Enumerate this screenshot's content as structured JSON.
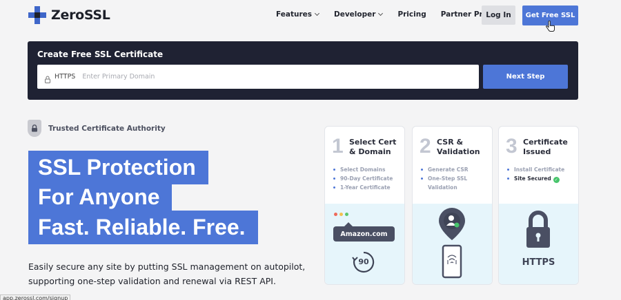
{
  "brand": {
    "name": "ZeroSSL"
  },
  "nav": {
    "items": [
      {
        "label": "Features"
      },
      {
        "label": "Developer"
      },
      {
        "label": "Pricing"
      },
      {
        "label": "Partner Program"
      }
    ],
    "login_label": "Log In",
    "cta_label": "Get Free SSL"
  },
  "create": {
    "title": "Create Free SSL Certificate",
    "prefix": "HTTPS",
    "placeholder": "Enter Primary Domain",
    "value": "",
    "button_label": "Next Step"
  },
  "trust": {
    "label": "Trusted Certificate Authority"
  },
  "hero": {
    "lines": [
      "SSL Protection",
      "For Anyone",
      "Fast. Reliable. Free."
    ],
    "description": "Easily secure any site by putting SSL management on autopilot, supporting one-step validation and renewal via REST API."
  },
  "steps": [
    {
      "number": "1",
      "title": "Select Cert & Domain",
      "items": [
        "Select Domains",
        "90-Day Certificate",
        "1-Year Certificate"
      ],
      "illustration": {
        "site": "Amazon.com",
        "days": "90"
      }
    },
    {
      "number": "2",
      "title": "CSR & Validation",
      "items": [
        "Generate CSR",
        "One-Step SSL Validation"
      ]
    },
    {
      "number": "3",
      "title": "Certificate Issued",
      "items": [
        "Install Certificate",
        "Site Secured"
      ],
      "illustration": {
        "label": "HTTPS"
      }
    }
  ],
  "status_bar": {
    "url": "app.zerossl.com/signup"
  },
  "colors": {
    "accent": "#4d76d7",
    "panel": "#1f2233",
    "success": "#47c46b"
  }
}
